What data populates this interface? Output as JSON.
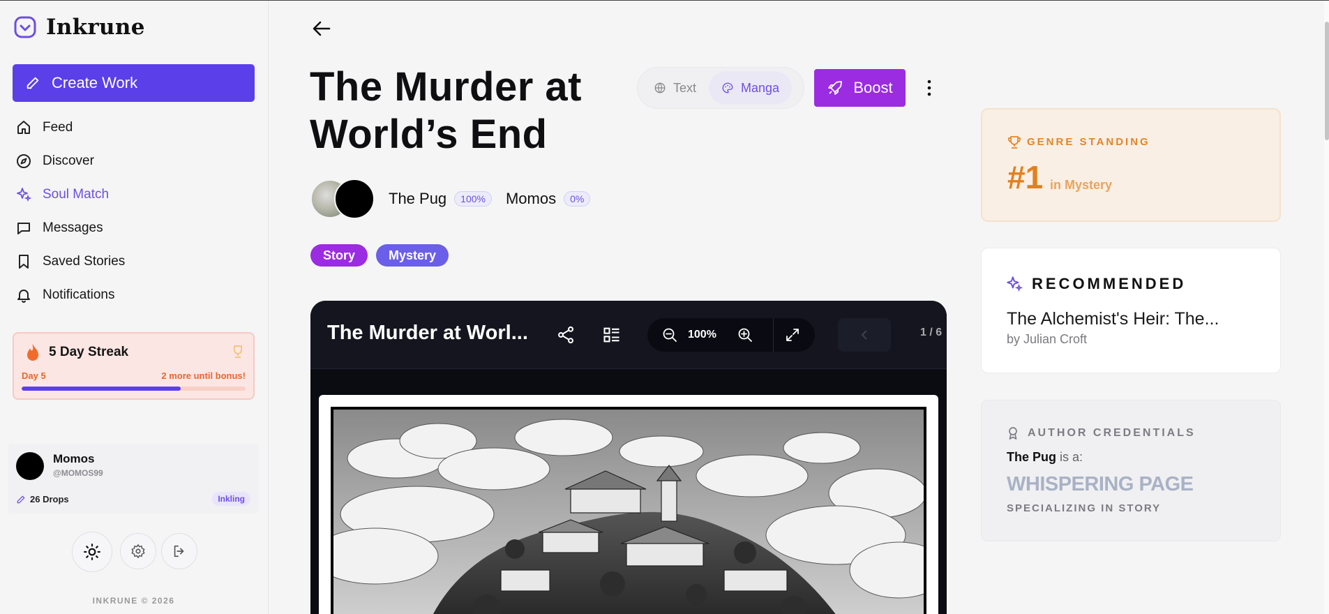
{
  "app": {
    "name": "Inkrune"
  },
  "sidebar": {
    "create_label": "Create Work",
    "items": [
      {
        "label": "Feed",
        "icon": "home-icon",
        "active": false
      },
      {
        "label": "Discover",
        "icon": "compass-icon",
        "active": false
      },
      {
        "label": "Soul Match",
        "icon": "sparkles-icon",
        "active": true
      },
      {
        "label": "Messages",
        "icon": "message-icon",
        "active": false
      },
      {
        "label": "Saved Stories",
        "icon": "bookmark-icon",
        "active": false
      },
      {
        "label": "Notifications",
        "icon": "bell-icon",
        "active": false
      }
    ],
    "streak": {
      "title": "5 Day Streak",
      "day": "Day 5",
      "bonus": "2 more until bonus!",
      "progress": 0.71
    },
    "user": {
      "name": "Momos",
      "handle": "@MOMOS99",
      "drops": "26 Drops",
      "badge": "Inkling"
    },
    "footer": "INKRUNE © 2026"
  },
  "work": {
    "title": "The Murder at World’s End",
    "modes": [
      {
        "label": "Text",
        "icon": "globe-icon",
        "active": false
      },
      {
        "label": "Manga",
        "icon": "palette-icon",
        "active": true
      }
    ],
    "boost_label": "Boost",
    "authors": [
      {
        "name": "The Pug",
        "pct": "100%"
      },
      {
        "name": "Momos",
        "pct": "0%"
      }
    ],
    "tags": [
      {
        "label": "Story",
        "color": "#9b2ce1"
      },
      {
        "label": "Mystery",
        "color": "#6b5ee8"
      }
    ]
  },
  "reader": {
    "title": "The Murder at Worl...",
    "zoom": "100%",
    "page": "1 / 6"
  },
  "genre": {
    "label": "GENRE STANDING",
    "rank": "#1",
    "genre_text": "in Mystery"
  },
  "recommended": {
    "label": "RECOMMENDED",
    "title": "The Alchemist's Heir: The...",
    "by": "by Julian Croft"
  },
  "credentials": {
    "label": "AUTHOR CREDENTIALS",
    "author": "The Pug",
    "is_a": " is a:",
    "rank": "WHISPERING PAGE",
    "spec": "SPECIALIZING IN STORY"
  },
  "colors": {
    "accent": "#5b3fe8",
    "boost": "#9b2ce1",
    "streak_orange": "#e8672a",
    "genre_orange": "#e2801e"
  }
}
